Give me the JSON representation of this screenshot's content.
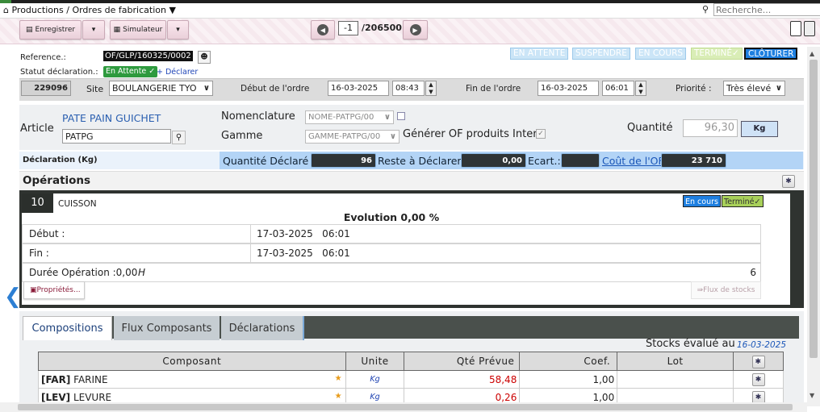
{
  "breadcrumb": "Productions / Ordres de fabrication",
  "search": {
    "placeholder": "Recherche..."
  },
  "toolbar": {
    "save_label": "Enregistrer",
    "simulate_label": "Simulateur",
    "page_current": "-1",
    "page_total": "/206500"
  },
  "header": {
    "reference_label": "Reference.:",
    "reference_value": "OF/GLP/160325/0002",
    "statut_label": "Statut déclaration.:",
    "statut_value": "En Attente",
    "declarer_label": "+ Déclarer",
    "status_buttons": [
      "EN ATTENTE",
      "SUSPENDRE",
      "EN COURS",
      "TERMINÉ",
      "CLÔTURER"
    ]
  },
  "info": {
    "id": "229096",
    "site_label": "Site",
    "site_value": "BOULANGERIE TYO",
    "debut_label": "Début de l'ordre",
    "debut_date": "16-03-2025",
    "debut_time": "08:43",
    "fin_label": "Fin de l'ordre",
    "fin_date": "16-03-2025",
    "fin_time": "06:01",
    "priorite_label": "Priorité :",
    "priorite_value": "Très élevé"
  },
  "article": {
    "label": "Article",
    "name": "PATE PAIN GUICHET",
    "code": "PATPG",
    "nomenclature_label": "Nomenclature",
    "nomenclature_value": "NOME-PATPG/00",
    "gamme_label": "Gamme",
    "gamme_value": "GAMME-PATPG/00",
    "generer_label": "Générer OF produits Inter",
    "quantite_label": "Quantité",
    "quantite_value": "96,30",
    "unit": "Kg"
  },
  "declaration": {
    "title": "Déclaration (Kg)",
    "qte_declare_label": "Quantité Déclaré :",
    "qte_declare_value": "96",
    "reste_label": "Reste à Déclarer:",
    "reste_value": "0,00",
    "ecart_label": "Ecart.:",
    "ecart_value": "",
    "cout_label": "Coût de l'OF",
    "cout_value": "23 710"
  },
  "operations": {
    "title": "Opérations",
    "op_number": "10",
    "op_name": "CUISSON",
    "badge_en_cours": "En cours",
    "badge_termine": "Terminé",
    "evolution": "Evolution 0,00 %",
    "debut_label": "Début :",
    "debut_value": "17-03-2025   06:01",
    "fin_label": "Fin :",
    "fin_value": "17-03-2025   06:01",
    "duree_label": "Durée Opération :0,00",
    "duree_unit": "H",
    "duree_count": "6",
    "proprietes_label": "Propriétés...",
    "flux_label": "Flux de stocks"
  },
  "tabs": [
    "Compositions",
    "Flux Composants",
    "Déclarations"
  ],
  "stocks": {
    "label": "Stocks évalué au",
    "date": "16-03-2025"
  },
  "table": {
    "headers": [
      "Composant",
      "Unite",
      "Qté Prévue",
      "Coef.",
      "Lot"
    ],
    "rows": [
      {
        "code": "[FAR]",
        "name": "FARINE",
        "unite": "Kg",
        "qte": "58,48",
        "coef": "1,00",
        "lot": ""
      },
      {
        "code": "[LEV]",
        "name": "LEVURE",
        "unite": "Kg",
        "qte": "0,26",
        "coef": "1,00",
        "lot": ""
      }
    ]
  },
  "colors": {
    "accent_blue": "#1e7fe0",
    "status_green": "#3a9a3a",
    "dark_panel": "#2f3330",
    "qty_red": "#cc0000"
  }
}
